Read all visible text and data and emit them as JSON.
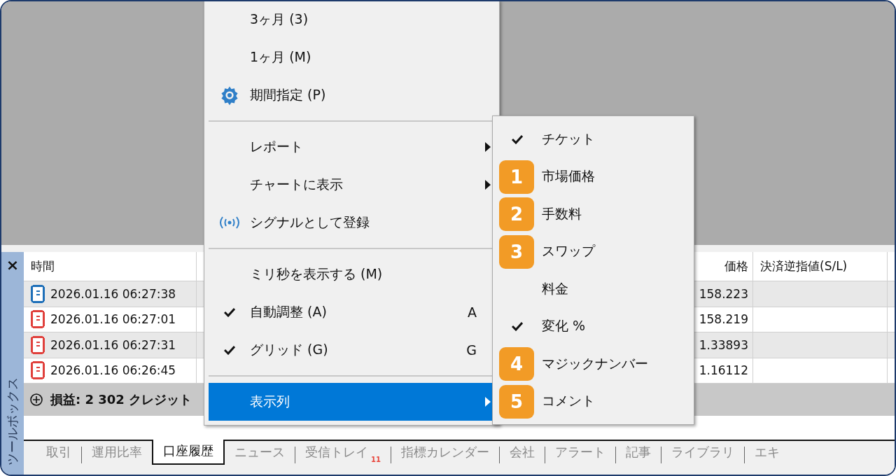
{
  "context_menu": {
    "items": [
      {
        "kind": "item",
        "label": "3ヶ月 (3)",
        "checked": false,
        "submenu": false,
        "selected": false
      },
      {
        "kind": "item",
        "label": "1ヶ月 (M)",
        "checked": false,
        "submenu": false,
        "selected": false
      },
      {
        "kind": "gear",
        "label": "期間指定 (P)",
        "checked": false,
        "submenu": false,
        "selected": false
      },
      {
        "kind": "separator"
      },
      {
        "kind": "item",
        "label": "レポート",
        "checked": false,
        "submenu": true,
        "selected": false
      },
      {
        "kind": "item",
        "label": "チャートに表示",
        "checked": false,
        "submenu": true,
        "selected": false
      },
      {
        "kind": "signal",
        "label": "シグナルとして登録",
        "checked": false,
        "submenu": false,
        "selected": false
      },
      {
        "kind": "separator"
      },
      {
        "kind": "item",
        "label": "ミリ秒を表示する (M)",
        "checked": false,
        "submenu": false,
        "selected": false
      },
      {
        "kind": "item",
        "label": "自動調整 (A)",
        "shortcut": "A",
        "checked": true,
        "submenu": false,
        "selected": false
      },
      {
        "kind": "item",
        "label": "グリッド (G)",
        "shortcut": "G",
        "checked": true,
        "submenu": false,
        "selected": false
      },
      {
        "kind": "separator"
      },
      {
        "kind": "item",
        "label": "表示列",
        "checked": false,
        "submenu": true,
        "selected": true
      }
    ]
  },
  "columns_submenu": {
    "items": [
      {
        "label": "チケット",
        "checked": true
      },
      {
        "label": "市場価格",
        "checked": false,
        "badge": "1"
      },
      {
        "label": "手数料",
        "checked": false,
        "badge": "2"
      },
      {
        "label": "スワップ",
        "checked": false,
        "badge": "3"
      },
      {
        "label": "料金",
        "checked": false
      },
      {
        "label": "変化 %",
        "checked": true
      },
      {
        "label": "マジックナンバー",
        "checked": false,
        "badge": "4"
      },
      {
        "label": "コメント",
        "checked": false,
        "badge": "5"
      }
    ]
  },
  "toolbox": {
    "title": "ツールボックス",
    "close": "×",
    "table": {
      "columns": [
        "時間",
        "価格",
        "決済逆指値(S/L)"
      ],
      "rows": [
        {
          "time": "2026.01.16 06:27:38",
          "price": "158.223",
          "color": "#1e6fb8"
        },
        {
          "time": "2026.01.16 06:27:01",
          "price": "158.219",
          "color": "#e0403c"
        },
        {
          "time": "2026.01.16 06:27:31",
          "price": "1.33893",
          "color": "#e0403c"
        },
        {
          "time": "2026.01.16 06:26:45",
          "price": "1.16112",
          "color": "#e0403c"
        }
      ],
      "summary": "損益: 2 302 クレジット"
    },
    "tabs": [
      {
        "label": "取引",
        "selected": false
      },
      {
        "label": "運用比率",
        "selected": false
      },
      {
        "label": "口座履歴",
        "selected": true
      },
      {
        "label": "ニュース",
        "selected": false
      },
      {
        "label": "受信トレイ",
        "count": "11",
        "selected": false
      },
      {
        "label": "指標カレンダー",
        "selected": false
      },
      {
        "label": "会社",
        "selected": false
      },
      {
        "label": "アラート",
        "selected": false
      },
      {
        "label": "記事",
        "selected": false
      },
      {
        "label": "ライブラリ",
        "selected": false
      },
      {
        "label": "エキ",
        "selected": false
      }
    ]
  }
}
